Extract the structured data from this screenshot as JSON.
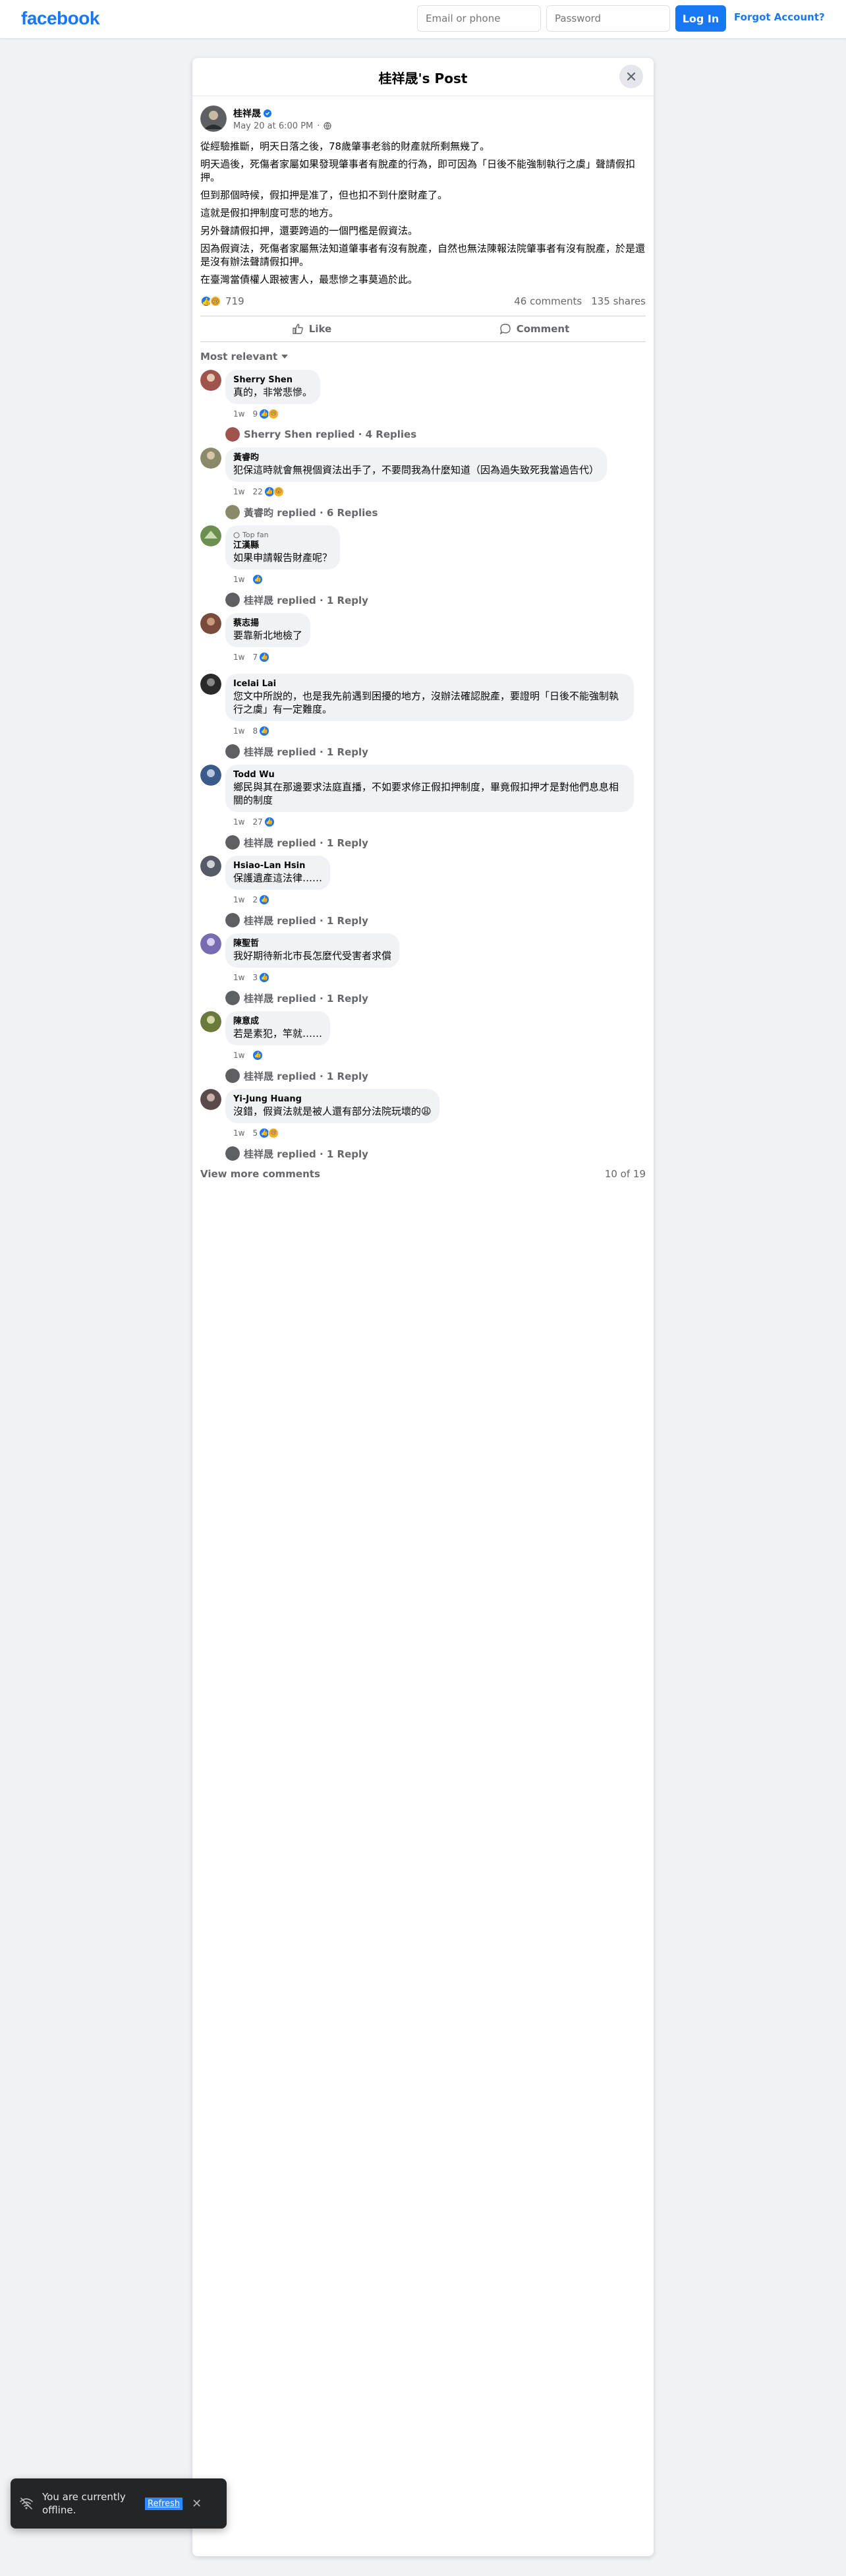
{
  "header": {
    "logo": "facebook",
    "email_placeholder": "Email or phone",
    "password_placeholder": "Password",
    "login_label": "Log In",
    "forgot_label": "Forgot Account?"
  },
  "post": {
    "title": "桂祥晟's Post",
    "author": "桂祥晟",
    "date": "May 20 at 6:00 PM",
    "paragraphs": [
      "從經驗推斷，明天日落之後，78歲肇事老翁的財產就所剩無幾了。",
      "明天過後，死傷者家屬如果發現肇事者有脫產的行為，即可因為「日後不能強制執行之虞」聲請假扣押。",
      "但到那個時候，假扣押是准了，但也扣不到什麼財產了。",
      "這就是假扣押制度可悲的地方。",
      "另外聲請假扣押，還要跨過的一個門檻是假資法。",
      "因為假資法，死傷者家屬無法知道肇事者有沒有脫產，自然也無法陳報法院肇事者有沒有脫產，於是還是沒有辦法聲請假扣押。",
      "在臺灣當債權人跟被害人，最悲慘之事莫過於此。"
    ],
    "reaction_count": "719",
    "comments_count": "46 comments",
    "shares_count": "135 shares",
    "like_label": "Like",
    "comment_label": "Comment",
    "sort_label": "Most relevant"
  },
  "comments": [
    {
      "name": "Sherry Shen",
      "text": "真的，非常悲慘。",
      "time": "1w",
      "reacts": "9",
      "reply_text": "Sherry Shen replied · 4 Replies",
      "avatar_color": "#a0524d"
    },
    {
      "name": "黃睿昀",
      "text": "犯保這時就會無視個資法出手了，不要問我為什麼知道（因為過失致死我當過告代）",
      "time": "1w",
      "reacts": "22",
      "reply_text": "黃睿昀 replied · 6 Replies",
      "avatar_color": "#8a8a6a"
    },
    {
      "name": "江漢縣",
      "badge": "Top fan",
      "text": "如果申請報告財產呢？",
      "time": "1w",
      "reacts": "",
      "reply_text": "桂祥晟 replied · 1 Reply",
      "avatar_color": "#6b8f4e"
    },
    {
      "name": "蔡志揚",
      "text": "要靠新北地檢了",
      "time": "1w",
      "reacts": "7",
      "reply_text": "",
      "avatar_color": "#7a4a3a"
    },
    {
      "name": "Icelai Lai",
      "text": "您文中所說的，也是我先前遇到困擾的地方，沒辦法確認脫產，要證明「日後不能強制執行之虞」有一定難度。",
      "time": "1w",
      "reacts": "8",
      "reply_text": "桂祥晟 replied · 1 Reply",
      "avatar_color": "#2a2a2a"
    },
    {
      "name": "Todd Wu",
      "text": "鄉民與其在那邊要求法庭直播，不如要求修正假扣押制度，畢竟假扣押才是對他們息息相關的制度",
      "time": "1w",
      "reacts": "27",
      "reply_text": "桂祥晟 replied · 1 Reply",
      "avatar_color": "#3a5a8a"
    },
    {
      "name": "Hsiao-Lan Hsin",
      "text": "保護遺產這法律……",
      "time": "1w",
      "reacts": "2",
      "reply_text": "桂祥晟 replied · 1 Reply",
      "avatar_color": "#555a66"
    },
    {
      "name": "陳聖哲",
      "text": "我好期待新北市長怎麼代受害者求償",
      "time": "1w",
      "reacts": "3",
      "reply_text": "桂祥晟 replied · 1 Reply",
      "avatar_color": "#7a6ab0"
    },
    {
      "name": "陳意成",
      "text": "若是素犯，竿就……",
      "time": "1w",
      "reacts": "",
      "reply_text": "桂祥晟 replied · 1 Reply",
      "avatar_color": "#6a7a3a"
    },
    {
      "name": "Yi-Jung Huang",
      "text": "沒錯，假資法就是被人還有部分法院玩壞的😩",
      "time": "1w",
      "reacts": "5",
      "reply_text": "桂祥晟 replied · 1 Reply",
      "avatar_color": "#5a4a4a"
    }
  ],
  "footer": {
    "view_more": "View more comments",
    "count": "10 of 19"
  },
  "toast": {
    "message": "You are currently offline.",
    "refresh": "Refresh"
  },
  "colors": {
    "brand": "#1877f2",
    "background": "#f0f2f5"
  }
}
